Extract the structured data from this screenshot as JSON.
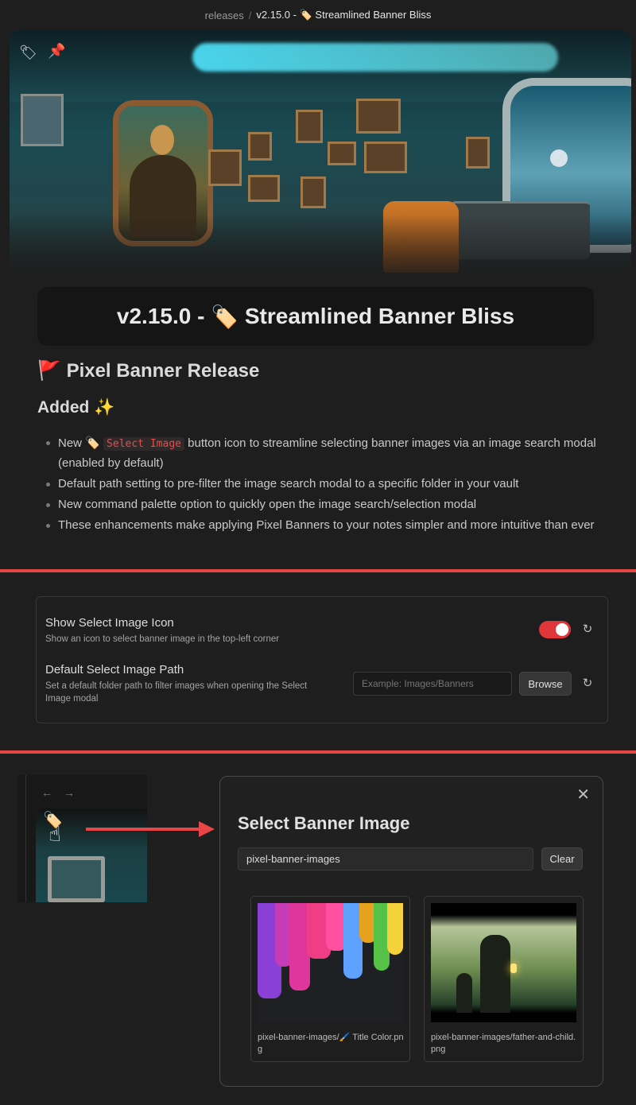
{
  "breadcrumb": {
    "root": "releases",
    "separator": "/",
    "current_version": "v2.15.0 -",
    "current_emoji": "🏷️",
    "current_title": "Streamlined Banner Bliss"
  },
  "banner": {
    "corner_icons": [
      "tag-icon",
      "pushpin-icon"
    ]
  },
  "title": {
    "version": "v2.15.0 -",
    "emoji": "🏷️",
    "text": "Streamlined Banner Bliss"
  },
  "release_heading": {
    "emoji": "🚩",
    "text": "Pixel Banner Release"
  },
  "added_heading": {
    "text": "Added",
    "emoji": "✨"
  },
  "bullets": {
    "b1_prefix": "New",
    "b1_emoji": "🏷️",
    "b1_code": "Select Image",
    "b1_suffix": "button icon to streamline selecting banner images via an image search modal (enabled by default)",
    "b2": "Default path setting to pre-filter the image search modal to a specific folder in your vault",
    "b3": "New command palette option to quickly open the image search/selection modal",
    "b4": "These enhancements make applying Pixel Banners to your notes simpler and more intuitive than ever"
  },
  "settings": {
    "icon_setting": {
      "name": "Show Select Image Icon",
      "description": "Show an icon to select banner image in the top-left corner",
      "enabled": true
    },
    "path_setting": {
      "name": "Default Select Image Path",
      "description": "Set a default folder path to filter images when opening the Select Image modal",
      "placeholder": "Example: Images/Banners",
      "browse_label": "Browse"
    },
    "reset_glyph": "↻"
  },
  "mini_pane": {
    "back_glyph": "←",
    "forward_glyph": "→",
    "tag_emoji": "🏷️",
    "hand_glyph": "☝"
  },
  "modal": {
    "close_glyph": "✕",
    "title": "Select Banner Image",
    "search_value": "pixel-banner-images",
    "clear_label": "Clear",
    "images": [
      {
        "caption": "pixel-banner-images/🖌️ Title Color.png"
      },
      {
        "caption": "pixel-banner-images/father-and-child.png"
      }
    ]
  },
  "colors": {
    "accent_red": "#e84646",
    "toggle_on": "#e0363a",
    "code_red": "#e04e4e",
    "background": "#1e1e1e"
  }
}
